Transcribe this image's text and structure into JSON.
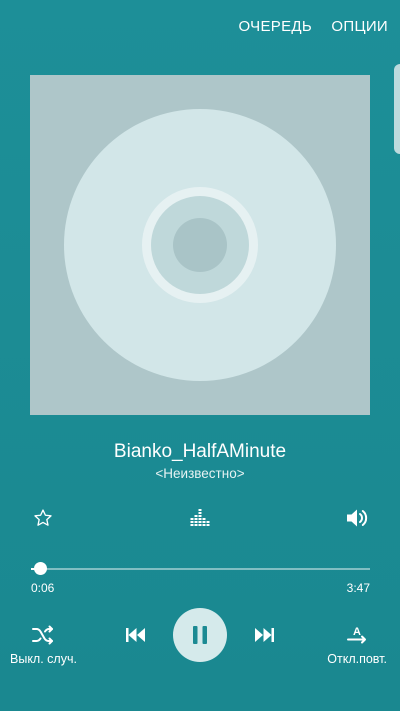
{
  "topbar": {
    "queue_label": "ОЧЕРЕДЬ",
    "options_label": "ОПЦИИ"
  },
  "colors": {
    "background": "#1b8a93",
    "album_bg": "#aec6c9",
    "disc": "#d2e6e8",
    "play_button_bg": "#d5eaeb",
    "icon_on_light": "#1b8a93"
  },
  "track": {
    "title": "Bianko_HalfAMinute",
    "artist": "<Неизвестно>"
  },
  "actions": {
    "favorite_icon": "star-outline-icon",
    "equalizer_icon": "equalizer-icon",
    "volume_icon": "volume-icon"
  },
  "progress": {
    "current_time": "0:06",
    "duration": "3:47",
    "fraction": 0.026
  },
  "controls": {
    "shuffle_icon": "shuffle-icon",
    "shuffle_label": "Выкл. случ.",
    "prev_icon": "skip-previous-icon",
    "play_state_icon": "pause-icon",
    "next_icon": "skip-next-icon",
    "repeat_icon": "repeat-off-icon",
    "repeat_label": "Откл.повт."
  }
}
